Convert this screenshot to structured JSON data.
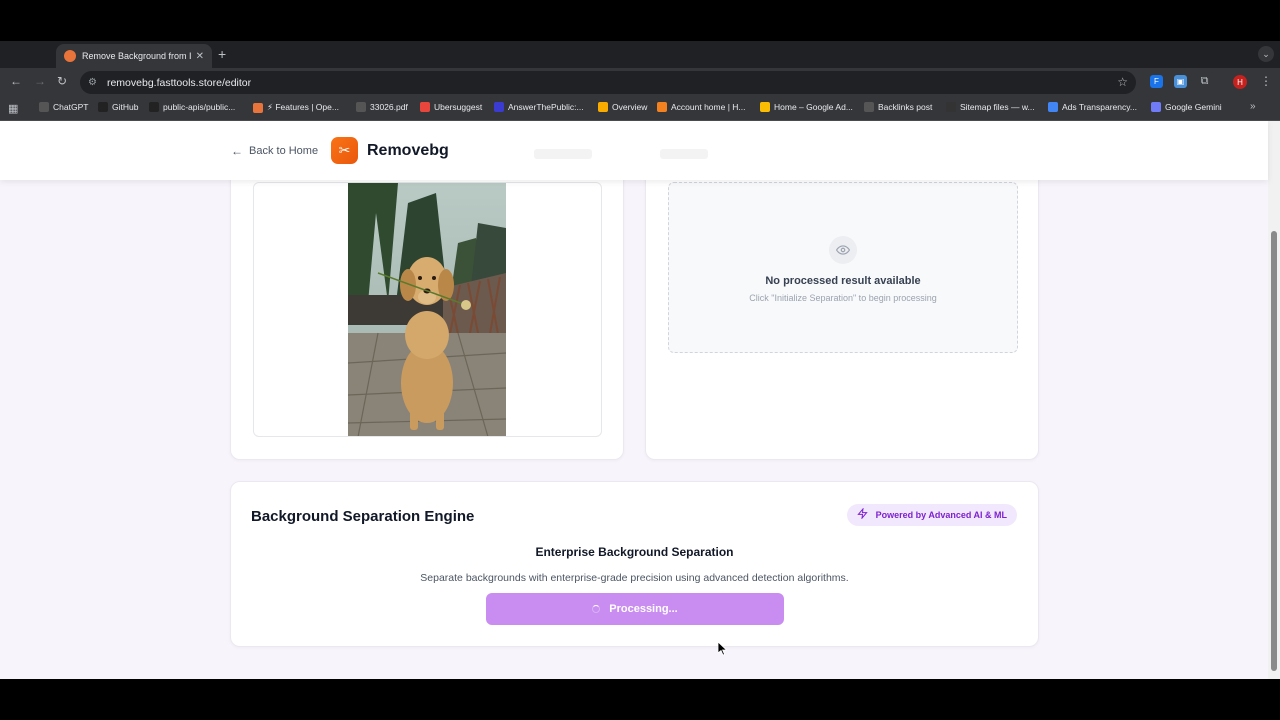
{
  "browser": {
    "tab_title": "Remove Background from Im",
    "url": "removebg.fasttools.store/editor",
    "profile_initial": "H",
    "bookmarks": [
      {
        "label": "ChatGPT",
        "color": "#555"
      },
      {
        "label": "GitHub",
        "color": "#222"
      },
      {
        "label": "public-apis/public...",
        "color": "#222"
      },
      {
        "label": "⚡ Features | Ope...",
        "color": "#e8743b"
      },
      {
        "label": "33026.pdf",
        "color": "#555"
      },
      {
        "label": "Ubersuggest",
        "color": "#e8453c"
      },
      {
        "label": "AnswerThePublic:...",
        "color": "#3b3bd1"
      },
      {
        "label": "Overview",
        "color": "#f9ab00"
      },
      {
        "label": "Account home | H...",
        "color": "#f48120"
      },
      {
        "label": "Home – Google Ad...",
        "color": "#fbbc04"
      },
      {
        "label": "Backlinks post",
        "color": "#555"
      },
      {
        "label": "Sitemap files — w...",
        "color": "#333"
      },
      {
        "label": "Ads Transparency...",
        "color": "#4285f4"
      },
      {
        "label": "Google Gemini",
        "color": "#6f7bf7"
      }
    ]
  },
  "header": {
    "back_label": "Back to Home",
    "brand": "Removebg"
  },
  "result_panel": {
    "title": "No processed result available",
    "subtitle": "Click \"Initialize Separation\" to begin processing"
  },
  "engine": {
    "title": "Background Separation Engine",
    "badge": "Powered by Advanced AI & ML",
    "subtitle": "Enterprise Background Separation",
    "description": "Separate backgrounds with enterprise-grade precision using advanced detection algorithms.",
    "button_label": "Processing..."
  },
  "colors": {
    "accent": "#7e22ce",
    "brand_orange": "#f97316",
    "button_fill": "#c98df1"
  }
}
